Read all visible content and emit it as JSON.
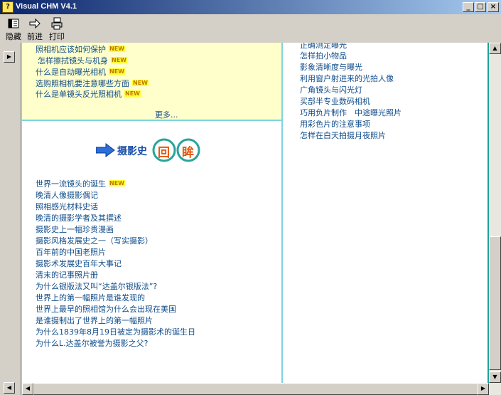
{
  "window": {
    "title": "Visual CHM V4.1"
  },
  "toolbar": {
    "hide": "隐藏",
    "forward": "前进",
    "print": "打印"
  },
  "left_pane": {
    "top_links": [
      "照相机应该如何保护",
      "怎样擦拭镜头与机身",
      "什么是自动曝光相机",
      "选购照相机要注意哪些方面",
      "什么是单镜头反光照相机"
    ],
    "new_badge": "NEW",
    "more": "更多...",
    "banner": {
      "part1": "摄影史",
      "char1": "回",
      "char2": "眸"
    },
    "history_links": [
      "世界一流镜头的诞生",
      "晚清人像摄影偶记",
      "照相感光材料史话",
      "晚清的摄影学者及其撰述",
      "摄影史上一幅珍贵漫画",
      "摄影风格发展史之一（写实摄影）",
      "百年前的中国老照片",
      "摄影术发展史百年大事记",
      "清末的记事照片册",
      "为什么银版法又叫“达盖尔银版法”?",
      "世界上的第一幅照片是谁发现的",
      "世界上最早的照相馆为什么会出现在美国",
      "是谁摄制出了世界上的第一幅照片",
      "为什么1839年8月19日被定为摄影术的诞生日",
      "为什么L.达盖尔被誉为摄影之父?"
    ]
  },
  "right_pane": {
    "links": [
      "正确测定曝光",
      "怎样拍小物品",
      "影象清晰度与曝光",
      "利用窗户射进来的光拍人像",
      "广角镜头与闪光灯",
      "买部半专业数码相机",
      "巧用负片制作　中途曝光照片",
      "用彩色片的注意事项",
      "怎样在白天拍摄月夜照片"
    ]
  },
  "colors": {
    "link": "#114d8a",
    "divider": "#7fd3df",
    "accent": "#1aa39a",
    "highlight": "#ffffcc"
  }
}
